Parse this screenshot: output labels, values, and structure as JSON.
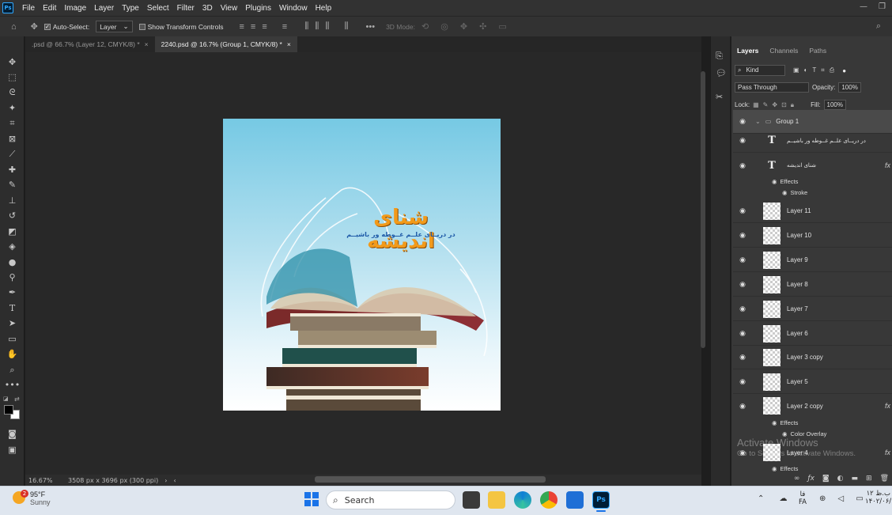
{
  "menubar": {
    "logo": "Ps",
    "items": [
      "File",
      "Edit",
      "Image",
      "Layer",
      "Type",
      "Select",
      "Filter",
      "3D",
      "View",
      "Plugins",
      "Window",
      "Help"
    ]
  },
  "options": {
    "auto_select_label": "Auto-Select:",
    "auto_select_value": "Layer",
    "transform_label": "Show Transform Controls",
    "mode_3d": "3D Mode:"
  },
  "tabs": [
    {
      "label": ".psd @ 66.7% (Layer 12, CMYK/8) *",
      "close": "×"
    },
    {
      "label": "2240.psd @ 16.7% (Group 1, CMYK/8) *",
      "close": "×"
    }
  ],
  "poster": {
    "title": "شنای اندیشه",
    "subtitle": "در دریــای علــم غــوطه ور باشیــم",
    "title_color": "#f29a1a",
    "subtitle_color": "#1e5aa8"
  },
  "status": {
    "zoom": "16.67%",
    "doc_info": "3508 px x 3696 px (300 ppi)"
  },
  "layers_panel": {
    "tabs": [
      "Layers",
      "Channels",
      "Paths"
    ],
    "kind": "Kind",
    "blend": "Pass Through",
    "opacity_label": "Opacity:",
    "opacity": "100%",
    "lock_label": "Lock:",
    "fill_label": "Fill:",
    "fill": "100%",
    "group_name": "Group 1",
    "text_layer_1": "در دریــای علــم غــوطه ور باشیــم",
    "text_layer_2": "شنای اندیشه",
    "effects_label": "Effects",
    "stroke_label": "Stroke",
    "color_overlay_label": "Color Overlay",
    "layers": [
      "Layer 11",
      "Layer 10",
      "Layer 9",
      "Layer 8",
      "Layer 7",
      "Layer 6",
      "Layer 3 copy",
      "Layer 5",
      "Layer 2 copy",
      "Layer 4"
    ],
    "fx": "fx"
  },
  "watermark": {
    "line1": "Activate Windows",
    "line2": "Go to Settings to activate Windows."
  },
  "taskbar": {
    "weather_temp": "95°F",
    "weather_desc": "Sunny",
    "weather_badge": "2",
    "search_placeholder": "Search",
    "lang_top": "فا",
    "lang_bottom": "FA",
    "time": "۱۲ ب.ظ",
    "date": "۱۴۰۲/۰۶/۰۵"
  }
}
